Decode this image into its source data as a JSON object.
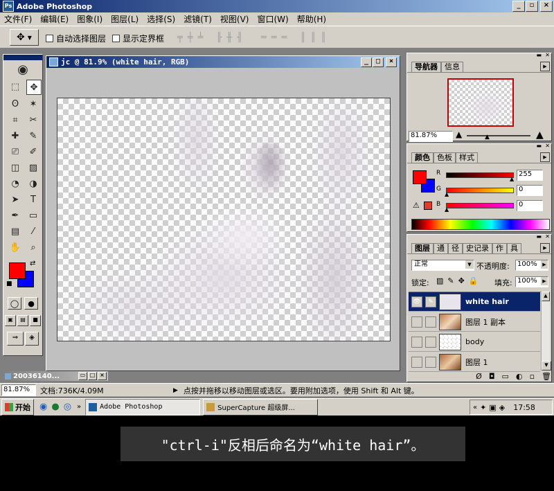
{
  "app": {
    "title": "Adobe Photoshop"
  },
  "menu": [
    "文件(F)",
    "编辑(E)",
    "图象(I)",
    "图层(L)",
    "选择(S)",
    "滤镜(T)",
    "视图(V)",
    "窗口(W)",
    "帮助(H)"
  ],
  "options": {
    "auto_select": "自动选择图层",
    "show_bounds": "显示定界框"
  },
  "document": {
    "title": "jc @ 81.9% (white hair, RGB)"
  },
  "minimized_doc": "20036140...",
  "navigator": {
    "tabs": [
      "导航器",
      "信息"
    ],
    "zoom": "81.87%"
  },
  "color": {
    "tabs": [
      "颜色",
      "色板",
      "样式"
    ],
    "r_label": "R",
    "g_label": "G",
    "b_label": "B",
    "r": "255",
    "g": "0",
    "b": "0",
    "fg": "#ff0000",
    "bg": "#0000ff"
  },
  "layers": {
    "tabs": [
      "图层",
      "通",
      "径",
      "史记录",
      "作",
      "具"
    ],
    "blend": "正常",
    "opacity_label": "不透明度:",
    "opacity": "100%",
    "lock_label": "锁定:",
    "fill_label": "填充:",
    "fill": "100%",
    "items": [
      {
        "name": "white hair",
        "selected": true,
        "visible": true
      },
      {
        "name": "图层 1 副本",
        "selected": false,
        "visible": false
      },
      {
        "name": "body",
        "selected": false,
        "visible": false
      },
      {
        "name": "图层 1",
        "selected": false,
        "visible": false
      }
    ]
  },
  "status": {
    "zoom": "81.87%",
    "doc": "文档:736K/4.09M",
    "hint": "点按并拖移以移动图层或选区。要用附加选项，使用 Shift 和 Alt 键。"
  },
  "taskbar": {
    "start": "开始",
    "tasks": [
      "Adobe Photoshop",
      "SuperCapture 超级屏..."
    ],
    "clock": "17:58"
  },
  "caption": "\"ctrl-i\"反相后命名为“white hair”。"
}
